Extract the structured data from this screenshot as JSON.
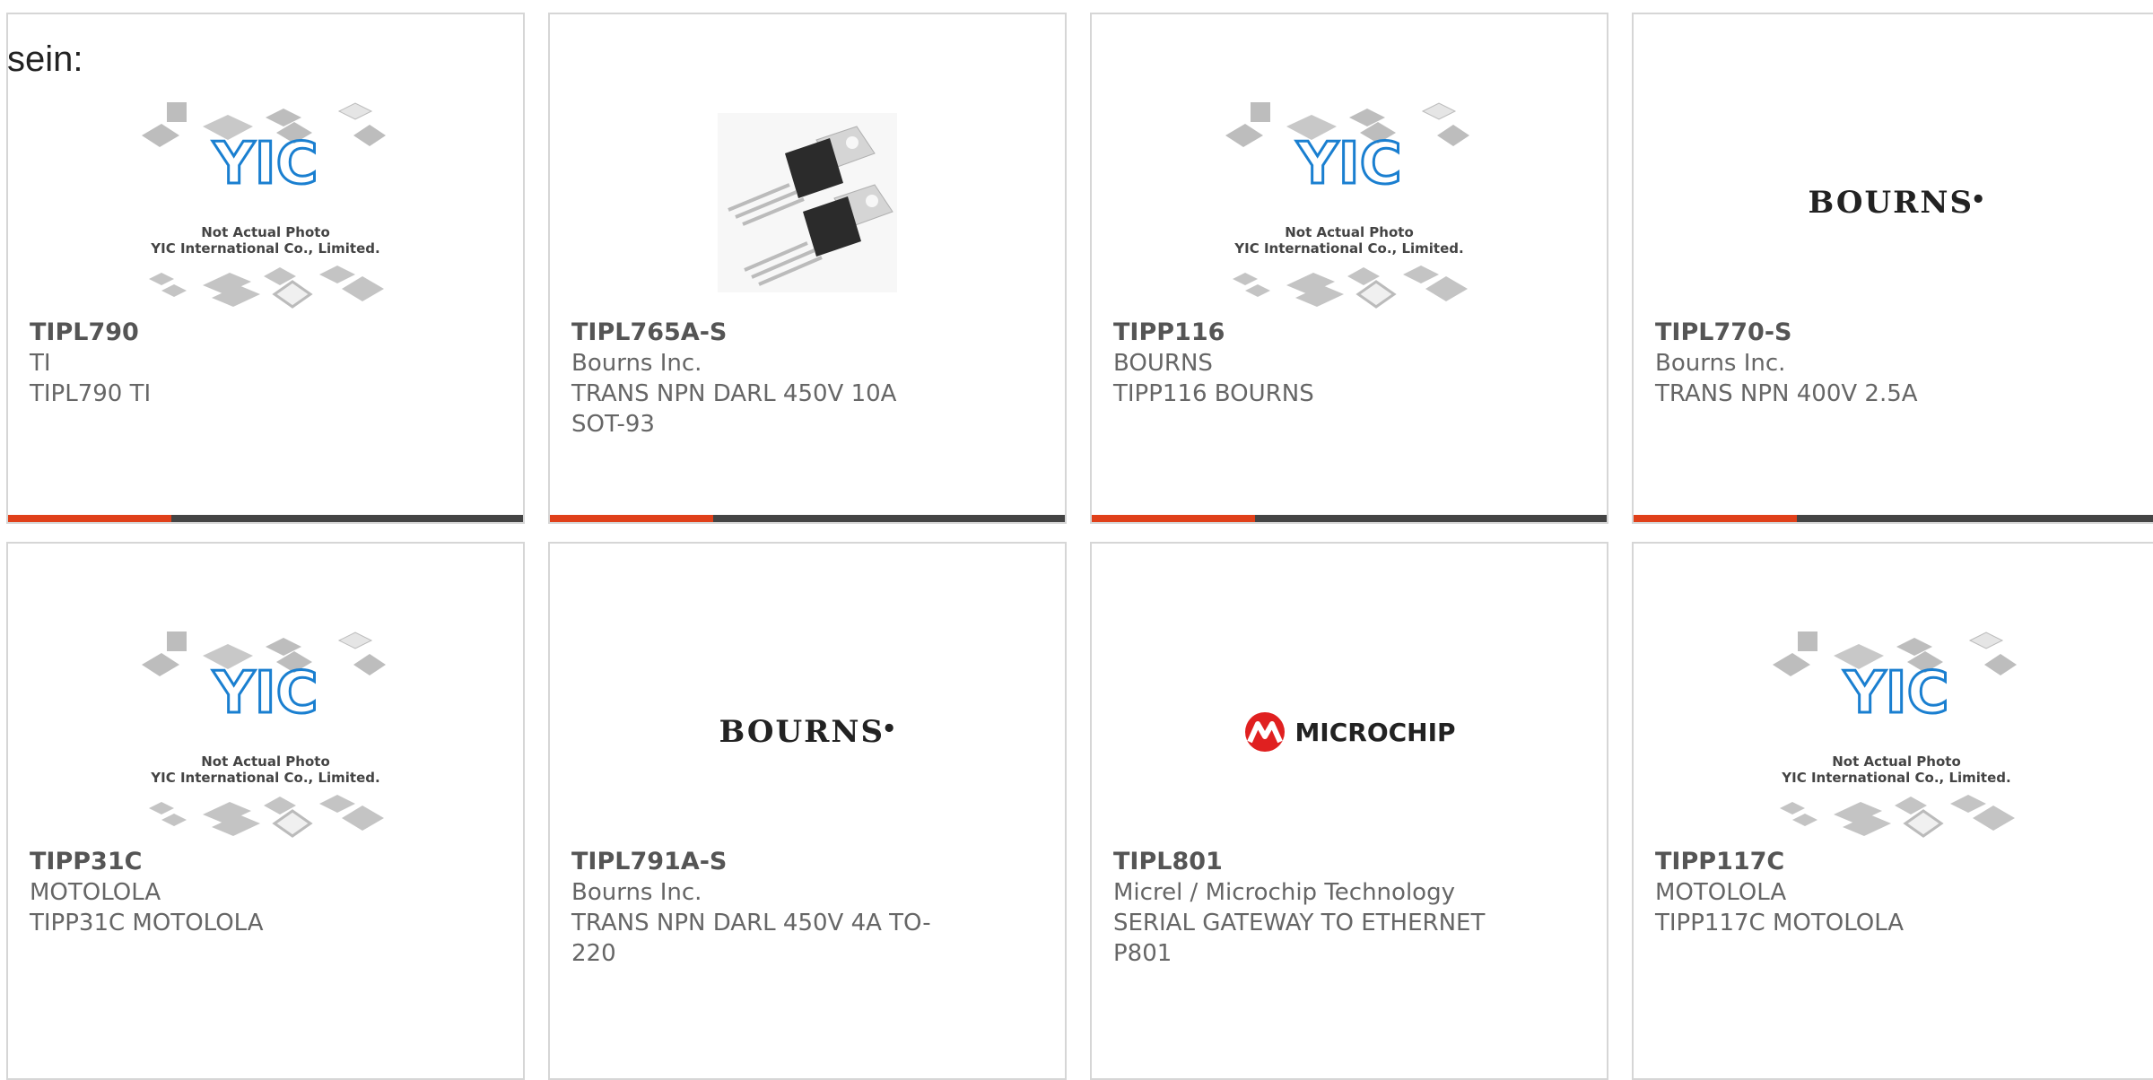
{
  "page": {
    "prefix_text": "sein:"
  },
  "colors": {
    "accent": "#e0401a",
    "bar": "#444444",
    "border": "#d6d6d6",
    "yic_blue": "#1a7fd0",
    "microchip_red": "#e02020"
  },
  "products": [
    {
      "part": "TIPL790",
      "manufacturer": "TI",
      "description": "TIPL790 TI",
      "image": "yic-placeholder-icon",
      "img_text1": "Not Actual Photo",
      "img_text2": "YIC International Co., Limited."
    },
    {
      "part": "TIPL765A-S",
      "manufacturer": "Bourns Inc.",
      "description": "TRANS NPN DARL 450V 10A SOT-93",
      "image": "transistor-photo"
    },
    {
      "part": "TIPP116",
      "manufacturer": "BOURNS",
      "description": "TIPP116 BOURNS",
      "image": "yic-placeholder-icon",
      "img_text1": "Not Actual Photo",
      "img_text2": "YIC International Co., Limited."
    },
    {
      "part": "TIPL770-S",
      "manufacturer": "Bourns Inc.",
      "description": "TRANS NPN 400V 2.5A",
      "image": "bourns-logo",
      "logo_text": "BOURNS"
    },
    {
      "part": "TIPP31C",
      "manufacturer": "MOTOLOLA",
      "description": "TIPP31C MOTOLOLA",
      "image": "yic-placeholder-icon",
      "img_text1": "Not Actual Photo",
      "img_text2": "YIC International Co., Limited."
    },
    {
      "part": "TIPL791A-S",
      "manufacturer": "Bourns Inc.",
      "description": "TRANS NPN DARL 450V 4A TO-220",
      "image": "bourns-logo",
      "logo_text": "BOURNS"
    },
    {
      "part": "TIPL801",
      "manufacturer": "Micrel / Microchip Technology",
      "description": "SERIAL GATEWAY TO ETHERNET P801",
      "image": "microchip-logo",
      "logo_text": "MICROCHIP"
    },
    {
      "part": "TIPP117C",
      "manufacturer": "MOTOLOLA",
      "description": "TIPP117C MOTOLOLA",
      "image": "yic-placeholder-icon",
      "img_text1": "Not Actual Photo",
      "img_text2": "YIC International Co., Limited."
    }
  ]
}
